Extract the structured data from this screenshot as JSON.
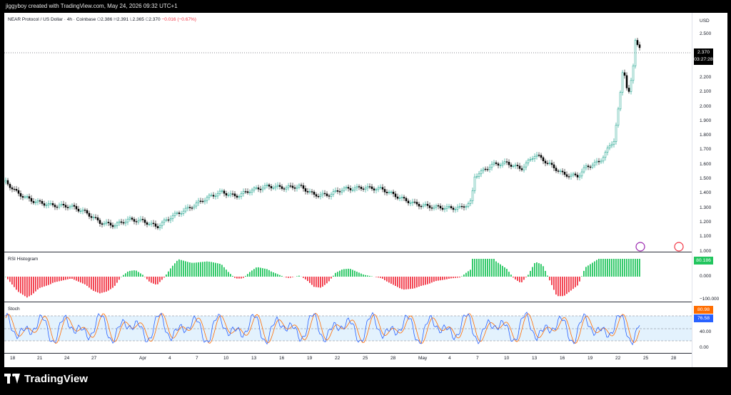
{
  "creator": "jiggyboy created with TradingView.com, May 24, 2026 09:32 UTC+1",
  "legend": {
    "symbol": "NEAR Protocol / US Dollar · 4h · Coinbase",
    "o_label": "O",
    "o": "2.386",
    "h_label": "H",
    "h": "2.391",
    "l_label": "L",
    "l": "2.365",
    "c_label": "C",
    "c": "2.370",
    "change": "−0.016 (−0.67%)"
  },
  "price_axis": {
    "currency": "USD",
    "ticks": [
      "2.500",
      "2.400",
      "2.300",
      "2.200",
      "2.100",
      "2.000",
      "1.900",
      "1.800",
      "1.700",
      "1.600",
      "1.500",
      "1.400",
      "1.300",
      "1.200",
      "1.100",
      "1.000"
    ],
    "current_price": "2.370",
    "countdown": "03:27:28"
  },
  "rsi_histogram": {
    "title": "RSI Histogram",
    "value": "80.186",
    "ticks": [
      "0.000",
      "−100.000"
    ]
  },
  "stoch": {
    "title": "Stoch",
    "k_value": "80.98",
    "d_value": "76.58",
    "ticks": [
      "40.00",
      "0.00"
    ]
  },
  "time_axis": [
    "18",
    "21",
    "24",
    "27",
    "Apr",
    "4",
    "7",
    "10",
    "13",
    "16",
    "19",
    "22",
    "25",
    "28",
    "May",
    "4",
    "7",
    "10",
    "13",
    "16",
    "19",
    "22",
    "25",
    "28"
  ],
  "colors": {
    "up": "#089981",
    "down": "#000000",
    "hist_pos": "#22c55e",
    "hist_neg": "#f23645",
    "k": "#2962ff",
    "d": "#ff6d00",
    "band": "#e3f2fd"
  },
  "branding": "TradingView"
}
